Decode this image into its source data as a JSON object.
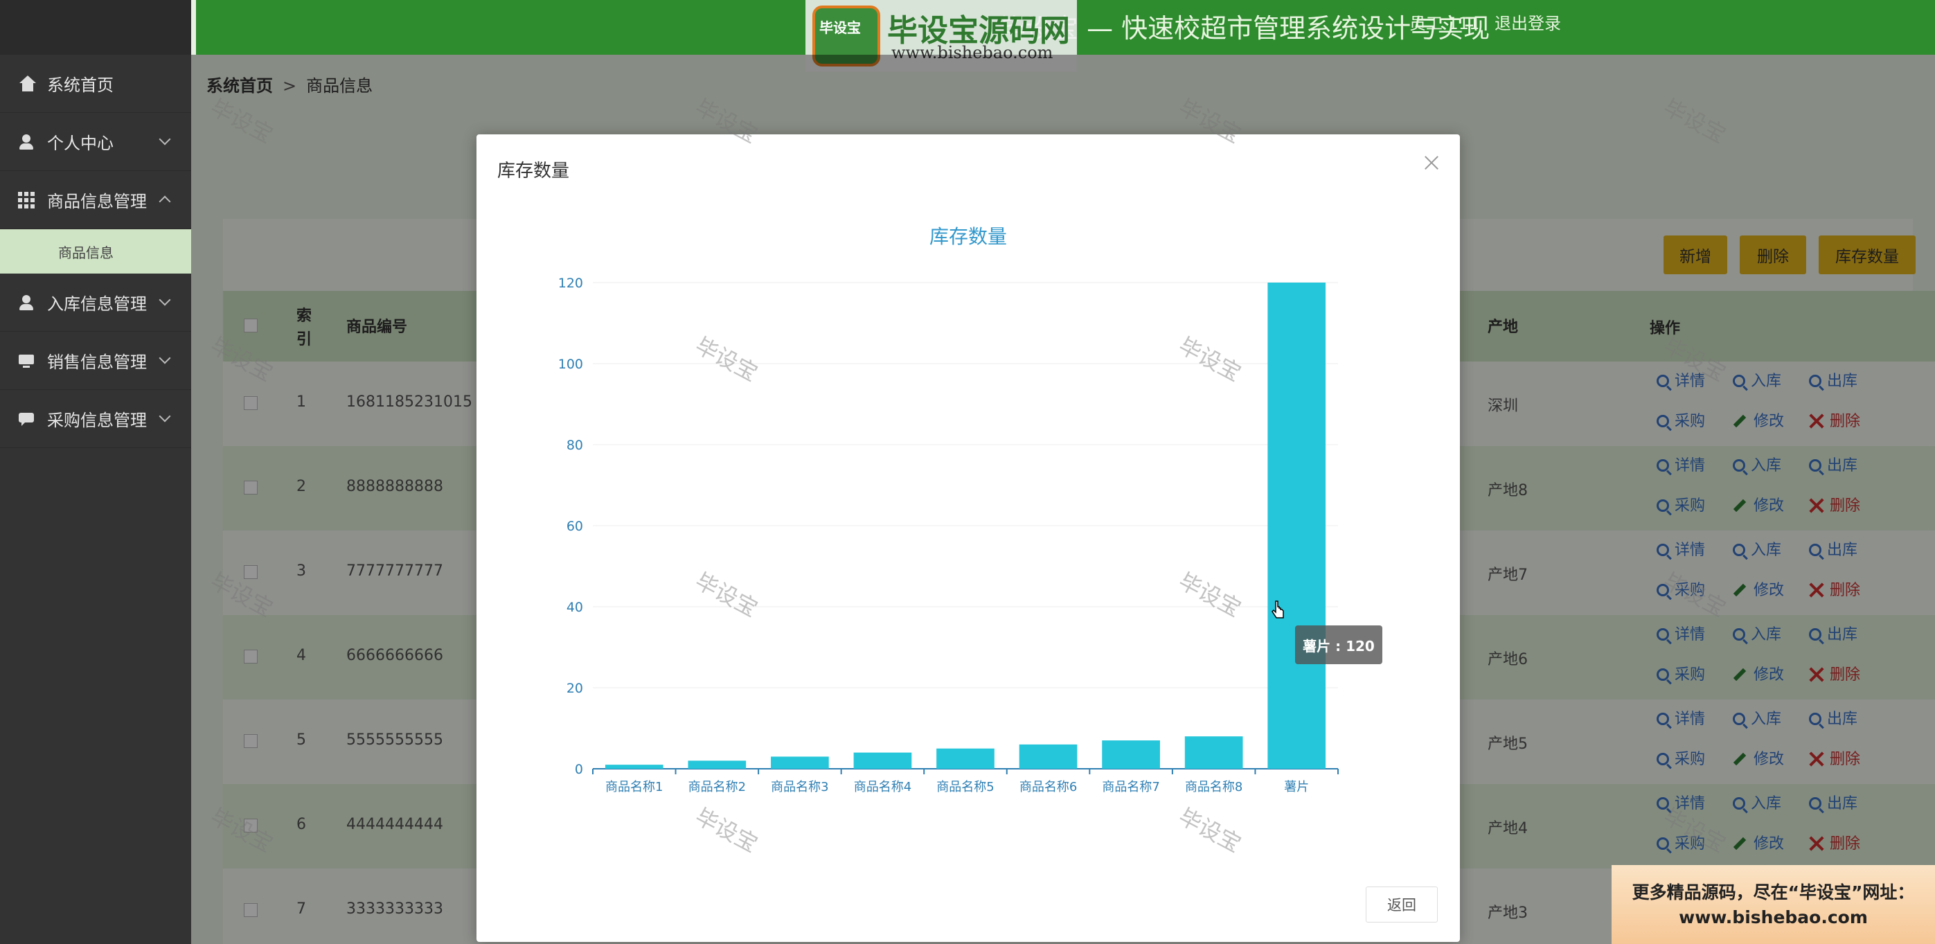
{
  "header": {
    "title": "毕设宝 — 快速校超市管理系统设计与实现",
    "user_name": "员工 111",
    "logout": "退出登录",
    "logo_mark": "毕设宝",
    "logo_brand": "毕设宝源码网",
    "logo_url": "www.bishebao.com"
  },
  "sidebar": {
    "items": [
      {
        "label": "系统首页",
        "icon": "home-icon"
      },
      {
        "label": "个人中心",
        "icon": "user-icon"
      },
      {
        "label": "商品信息管理",
        "icon": "grid-icon"
      },
      {
        "label": "入库信息管理",
        "icon": "user-icon"
      },
      {
        "label": "销售信息管理",
        "icon": "monitor-icon"
      },
      {
        "label": "采购信息管理",
        "icon": "chat-icon"
      }
    ],
    "sub_item": "商品信息"
  },
  "breadcrumb": {
    "home": "系统首页",
    "separator": ">",
    "current": "商品信息"
  },
  "toolbar": {
    "add": "新增",
    "delete": "删除",
    "stock": "库存数量"
  },
  "table": {
    "headers": {
      "index": "索引",
      "code": "商品编号",
      "origin": "产地",
      "ops": "操作"
    },
    "rows": [
      {
        "index": "1",
        "code": "1681185231015",
        "origin": "深圳"
      },
      {
        "index": "2",
        "code": "8888888888",
        "origin": "产地8"
      },
      {
        "index": "3",
        "code": "7777777777",
        "origin": "产地7"
      },
      {
        "index": "4",
        "code": "6666666666",
        "origin": "产地6"
      },
      {
        "index": "5",
        "code": "5555555555",
        "origin": "产地5"
      },
      {
        "index": "6",
        "code": "4444444444",
        "origin": "产地4"
      },
      {
        "index": "7",
        "code": "3333333333",
        "origin": "产地3"
      }
    ],
    "ops": {
      "detail": "详情",
      "in": "入库",
      "out": "出库",
      "purchase": "采购",
      "edit": "修改",
      "remove": "删除"
    }
  },
  "modal": {
    "title": "库存数量",
    "back": "返回",
    "tooltip": "薯片 : 120"
  },
  "watermark": "毕设宝",
  "ad": {
    "line1": "更多精品源码，尽在“毕设宝”网址：",
    "line2": "www.bishebao.com"
  },
  "colors": {
    "accent_green": "#2e8b2e",
    "bar": "#26c6da",
    "chart_title": "#3398cc",
    "button": "#e5b51c"
  },
  "chart_data": {
    "type": "bar",
    "title": "库存数量",
    "categories": [
      "商品名称1",
      "商品名称2",
      "商品名称3",
      "商品名称4",
      "商品名称5",
      "商品名称6",
      "商品名称7",
      "商品名称8",
      "薯片"
    ],
    "values": [
      1,
      2,
      3,
      4,
      5,
      6,
      7,
      8,
      120
    ],
    "ylim": [
      0,
      120
    ],
    "yticks": [
      0,
      20,
      40,
      60,
      80,
      100,
      120
    ],
    "grid": true
  }
}
